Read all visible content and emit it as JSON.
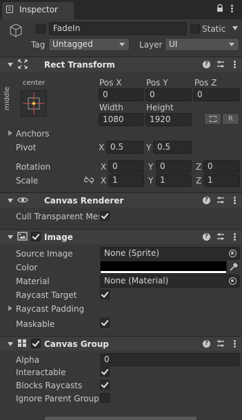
{
  "window": {
    "tab_title": "Inspector"
  },
  "object": {
    "name": "FadeIn",
    "static_label": "Static",
    "tag_label": "Tag",
    "tag_value": "Untagged",
    "layer_label": "Layer",
    "layer_value": "UI"
  },
  "rect_transform": {
    "title": "Rect Transform",
    "anchor_h": "center",
    "anchor_v": "middle",
    "pos_x_label": "Pos X",
    "pos_y_label": "Pos Y",
    "pos_z_label": "Pos Z",
    "pos_x": "0",
    "pos_y": "0",
    "pos_z": "0",
    "width_label": "Width",
    "height_label": "Height",
    "width": "1080",
    "height": "1920",
    "raw_button": "R",
    "anchors_label": "Anchors",
    "pivot_label": "Pivot",
    "pivot_x": "0.5",
    "pivot_y": "0.5",
    "rotation_label": "Rotation",
    "rot_x": "0",
    "rot_y": "0",
    "rot_z": "0",
    "scale_label": "Scale",
    "scale_x": "1",
    "scale_y": "1",
    "scale_z": "1",
    "x": "X",
    "y": "Y",
    "z": "Z"
  },
  "canvas_renderer": {
    "title": "Canvas Renderer",
    "cull_label": "Cull Transparent Mes",
    "cull_checked": true
  },
  "image": {
    "title": "Image",
    "source_label": "Source Image",
    "source_value": "None (Sprite)",
    "color_label": "Color",
    "color_value": "#000000",
    "material_label": "Material",
    "material_value": "None (Material)",
    "raycast_target_label": "Raycast Target",
    "raycast_padding_label": "Raycast Padding",
    "maskable_label": "Maskable"
  },
  "canvas_group": {
    "title": "Canvas Group",
    "alpha_label": "Alpha",
    "alpha_value": "0",
    "interactable_label": "Interactable",
    "blocks_label": "Blocks Raycasts",
    "ignore_label": "Ignore Parent Groups"
  }
}
